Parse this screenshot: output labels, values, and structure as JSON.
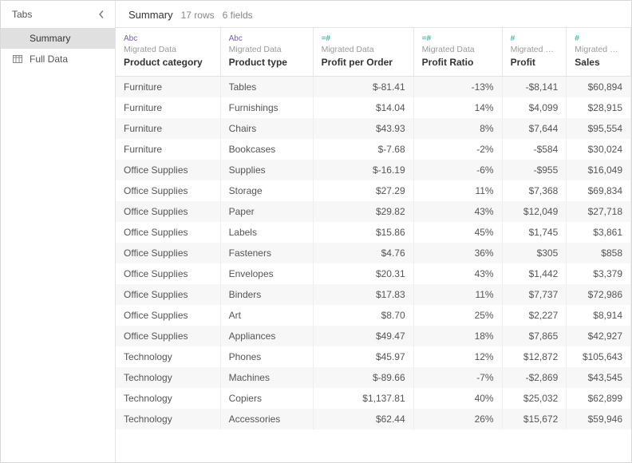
{
  "sidebar": {
    "title": "Tabs",
    "items": [
      {
        "label": "Summary",
        "active": true,
        "icon": ""
      },
      {
        "label": "Full Data",
        "active": false,
        "icon": "table"
      }
    ]
  },
  "header": {
    "title": "Summary",
    "rows_label": "17 rows",
    "fields_label": "6 fields"
  },
  "columns": [
    {
      "type_icon": "Abc",
      "type_class": "purple",
      "source": "Migrated Data",
      "name": "Product category",
      "align": "left"
    },
    {
      "type_icon": "Abc",
      "type_class": "purple",
      "source": "Migrated Data",
      "name": "Product type",
      "align": "left"
    },
    {
      "type_icon": "=#",
      "type_class": "teal",
      "source": "Migrated Data",
      "name": "Profit per Order",
      "align": "right"
    },
    {
      "type_icon": "=#",
      "type_class": "teal",
      "source": "Migrated Data",
      "name": "Profit Ratio",
      "align": "right"
    },
    {
      "type_icon": "#",
      "type_class": "teal",
      "source": "Migrated D...",
      "name": "Profit",
      "align": "right"
    },
    {
      "type_icon": "#",
      "type_class": "teal",
      "source": "Migrated D...",
      "name": "Sales",
      "align": "right"
    }
  ],
  "rows": [
    [
      "Furniture",
      "Tables",
      "$-81.41",
      "-13%",
      "-$8,141",
      "$60,894"
    ],
    [
      "Furniture",
      "Furnishings",
      "$14.04",
      "14%",
      "$4,099",
      "$28,915"
    ],
    [
      "Furniture",
      "Chairs",
      "$43.93",
      "8%",
      "$7,644",
      "$95,554"
    ],
    [
      "Furniture",
      "Bookcases",
      "$-7.68",
      "-2%",
      "-$584",
      "$30,024"
    ],
    [
      "Office Supplies",
      "Supplies",
      "$-16.19",
      "-6%",
      "-$955",
      "$16,049"
    ],
    [
      "Office Supplies",
      "Storage",
      "$27.29",
      "11%",
      "$7,368",
      "$69,834"
    ],
    [
      "Office Supplies",
      "Paper",
      "$29.82",
      "43%",
      "$12,049",
      "$27,718"
    ],
    [
      "Office Supplies",
      "Labels",
      "$15.86",
      "45%",
      "$1,745",
      "$3,861"
    ],
    [
      "Office Supplies",
      "Fasteners",
      "$4.76",
      "36%",
      "$305",
      "$858"
    ],
    [
      "Office Supplies",
      "Envelopes",
      "$20.31",
      "43%",
      "$1,442",
      "$3,379"
    ],
    [
      "Office Supplies",
      "Binders",
      "$17.83",
      "11%",
      "$7,737",
      "$72,986"
    ],
    [
      "Office Supplies",
      "Art",
      "$8.70",
      "25%",
      "$2,227",
      "$8,914"
    ],
    [
      "Office Supplies",
      "Appliances",
      "$49.47",
      "18%",
      "$7,865",
      "$42,927"
    ],
    [
      "Technology",
      "Phones",
      "$45.97",
      "12%",
      "$12,872",
      "$105,643"
    ],
    [
      "Technology",
      "Machines",
      "$-89.66",
      "-7%",
      "-$2,869",
      "$43,545"
    ],
    [
      "Technology",
      "Copiers",
      "$1,137.81",
      "40%",
      "$25,032",
      "$62,899"
    ],
    [
      "Technology",
      "Accessories",
      "$62.44",
      "26%",
      "$15,672",
      "$59,946"
    ]
  ]
}
